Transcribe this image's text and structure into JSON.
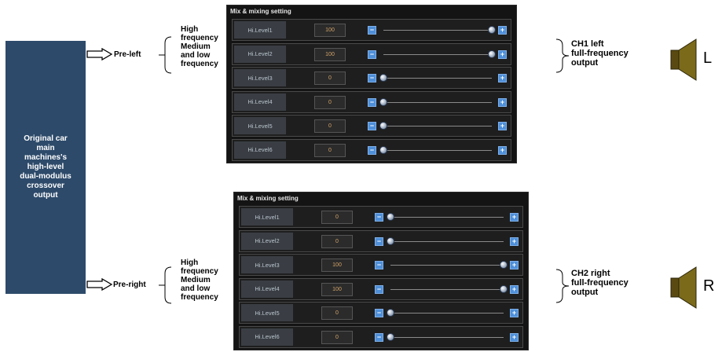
{
  "source": {
    "label": "Original car\nmain\nmachines's\nhigh-level\ndual-modulus\ncrossover\noutput"
  },
  "channels": [
    {
      "tap_label": "Pre-left",
      "band_label": "High\nfrequency\nMedium\nand low\nfrequency",
      "panel": {
        "title": "Mix & mixing setting",
        "rows": [
          {
            "name": "Hi.Level1",
            "value": "100",
            "level": 1.0
          },
          {
            "name": "Hi.Level2",
            "value": "100",
            "level": 1.0
          },
          {
            "name": "Hi.Level3",
            "value": "0",
            "level": 0.0
          },
          {
            "name": "Hi.Level4",
            "value": "0",
            "level": 0.0
          },
          {
            "name": "Hi.Level5",
            "value": "0",
            "level": 0.0
          },
          {
            "name": "Hi.Level6",
            "value": "0",
            "level": 0.0
          }
        ]
      },
      "output_label": "CH1 left\nfull-frequency\noutput",
      "side": "L"
    },
    {
      "tap_label": "Pre-right",
      "band_label": "High\nfrequency\nMedium\nand low\nfrequency",
      "panel": {
        "title": "Mix & mixing setting",
        "rows": [
          {
            "name": "Hi.Level1",
            "value": "0",
            "level": 0.0
          },
          {
            "name": "Hi.Level2",
            "value": "0",
            "level": 0.0
          },
          {
            "name": "Hi.Level3",
            "value": "100",
            "level": 1.0
          },
          {
            "name": "Hi.Level4",
            "value": "100",
            "level": 1.0
          },
          {
            "name": "Hi.Level5",
            "value": "0",
            "level": 0.0
          },
          {
            "name": "Hi.Level6",
            "value": "0",
            "level": 0.0
          }
        ]
      },
      "output_label": "CH2 right\nfull-frequency\noutput",
      "side": "R"
    }
  ],
  "colors": {
    "source_box": "#2d4a6a",
    "panel_bg": "#141414",
    "button": "#4f8fd8",
    "value_text": "#d4a56a",
    "speaker_body": "#5a4a12",
    "speaker_cone": "#7a6a1a"
  }
}
